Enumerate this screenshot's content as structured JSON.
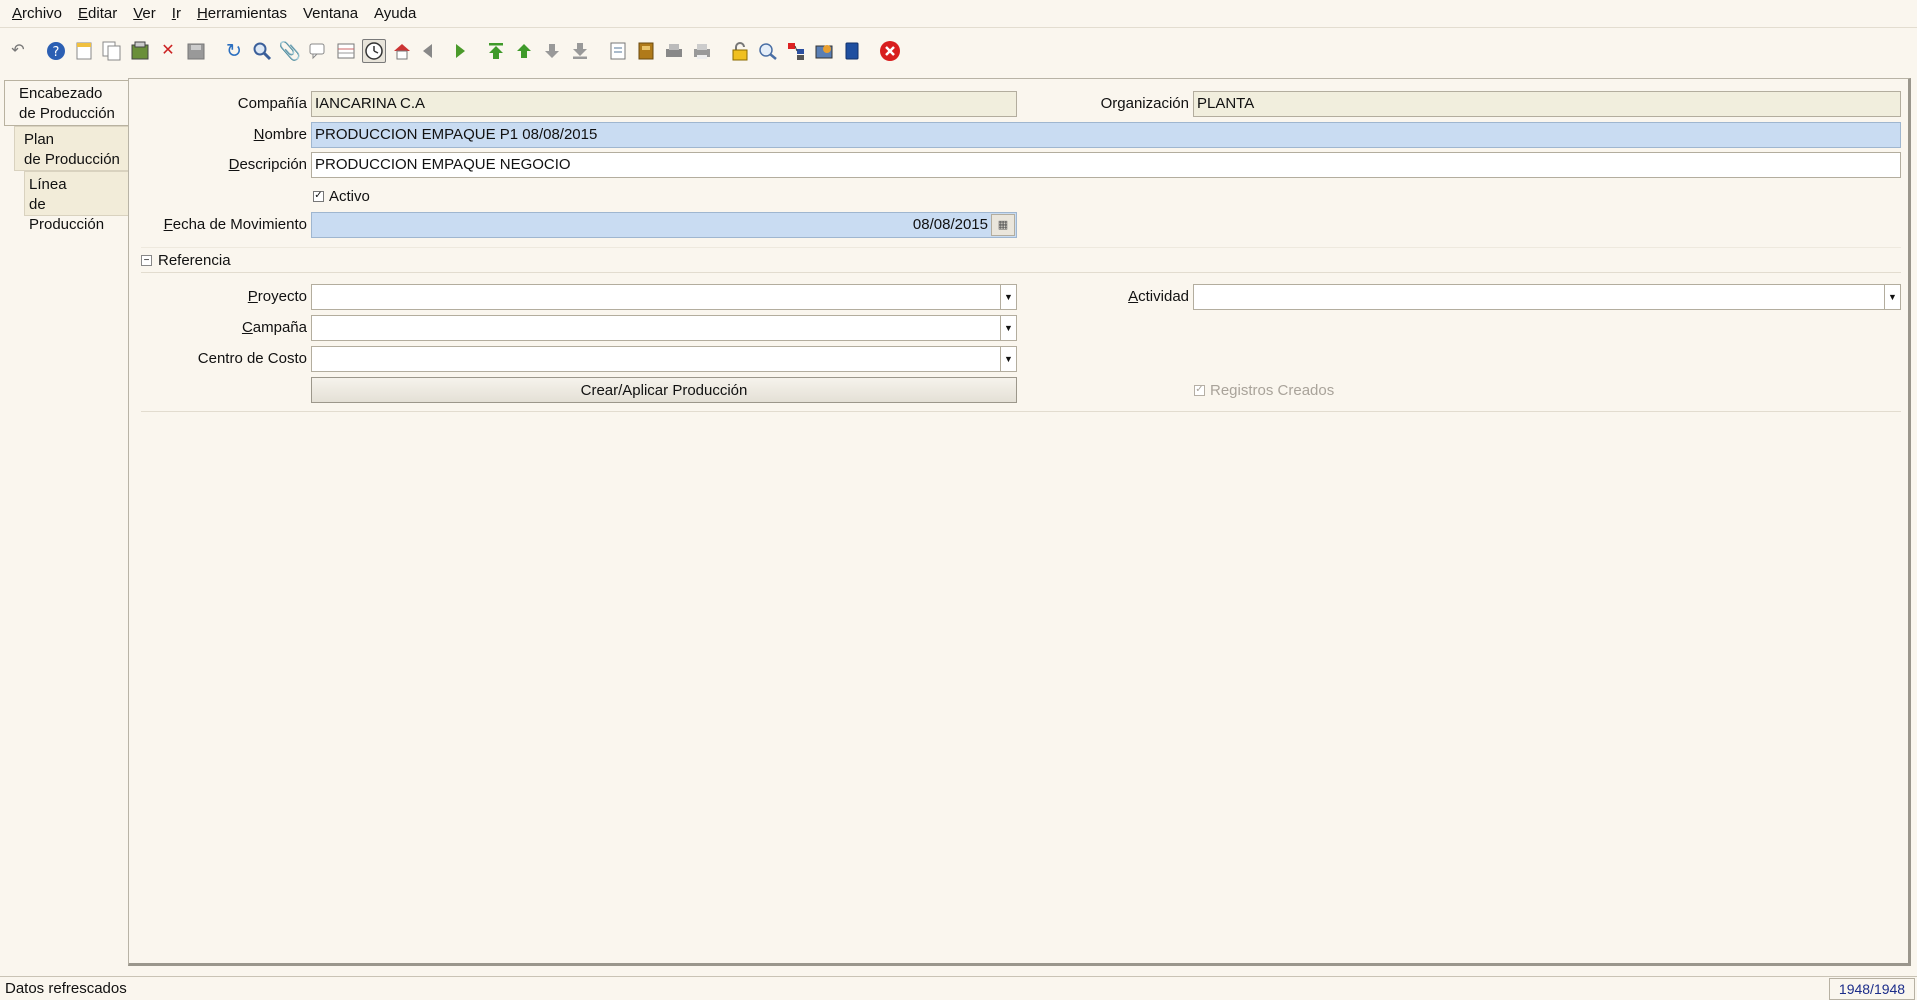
{
  "menu": {
    "items": [
      {
        "mn": "A",
        "rest": "rchivo"
      },
      {
        "mn": "E",
        "rest": "ditar"
      },
      {
        "mn": "V",
        "rest": "er"
      },
      {
        "mn": "I",
        "rest": "r"
      },
      {
        "mn": "H",
        "rest": "erramientas"
      },
      {
        "mn": "",
        "rest": "Ventana"
      },
      {
        "mn": "",
        "rest": "Ayuda"
      }
    ]
  },
  "toolbar": {
    "icons": [
      "undo-icon",
      "help-icon",
      "new-record-icon",
      "copy-record-icon",
      "save-icon",
      "delete-icon",
      "save-disabled-icon",
      "refresh-icon",
      "find-icon",
      "attachment-icon",
      "chat-icon",
      "grid-toggle-icon",
      "history-icon",
      "home-icon",
      "back-icon",
      "forward-icon",
      "first-record-icon",
      "previous-record-icon",
      "next-record-icon",
      "last-record-icon",
      "report-icon",
      "archive-icon",
      "print-preview-icon",
      "print-icon",
      "lock-icon",
      "zoom-across-icon",
      "workflow-icon",
      "process-icon",
      "product-info-icon",
      "exit-icon"
    ]
  },
  "tabs": [
    {
      "line1": "Encabezado",
      "line2": "de Producción"
    },
    {
      "line1": "Plan",
      "line2": "de Producción"
    },
    {
      "line1": "Línea",
      "line2": "de Producción"
    }
  ],
  "form": {
    "company_label": "Compañía",
    "company_value": "IANCARINA C.A",
    "org_label": "Organización",
    "org_value": "PLANTA",
    "name_label_mn": "N",
    "name_label_rest": "ombre",
    "name_value": "PRODUCCION  EMPAQUE  P1  08/08/2015",
    "desc_label_mn": "D",
    "desc_label_rest": "escripción",
    "desc_value": "PRODUCCION EMPAQUE   NEGOCIO",
    "active_label": "Activo",
    "date_label_mn": "F",
    "date_label_rest": "echa de Movimiento",
    "date_value": "08/08/2015",
    "section_title": "Referencia",
    "project_label_mn": "P",
    "project_label_rest": "royecto",
    "project_value": "",
    "activity_label_mn": "A",
    "activity_label_rest": "ctividad",
    "activity_value": "",
    "campaign_label_mn": "C",
    "campaign_label_rest": "ampaña",
    "campaign_value": "",
    "costcenter_label": "Centro de Costo",
    "costcenter_value": "",
    "process_button": "Crear/Aplicar Producción",
    "records_created_label": "Registros Creados"
  },
  "status": {
    "text": "Datos refrescados",
    "count": "1948/1948"
  }
}
